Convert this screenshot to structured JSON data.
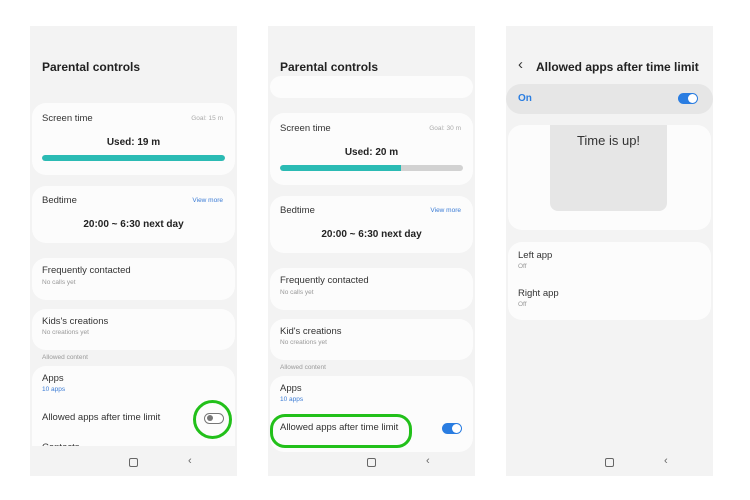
{
  "panel1": {
    "title": "Parental controls",
    "screen_time": {
      "label": "Screen time",
      "goal": "Goal: 15 m",
      "used": "Used: 19 m",
      "progress": 1.0
    },
    "bedtime": {
      "label": "Bedtime",
      "view_more": "View more",
      "time": "20:00 ~ 6:30 next day"
    },
    "frequent": {
      "label": "Frequently contacted",
      "sub": "No calls yet"
    },
    "creations": {
      "label": "Kids's creations",
      "sub": "No creations yet"
    },
    "section": "Allowed content",
    "apps": {
      "label": "Apps",
      "sub": "10 apps"
    },
    "allowed_apps": {
      "label": "Allowed apps after time limit",
      "toggle": "off"
    },
    "contacts": "Contacts"
  },
  "panel2": {
    "title": "Parental controls",
    "screen_time": {
      "label": "Screen time",
      "goal": "Goal: 30 m",
      "used": "Used: 20 m",
      "progress": 0.66
    },
    "bedtime": {
      "label": "Bedtime",
      "view_more": "View more",
      "time": "20:00 ~ 6:30 next day"
    },
    "frequent": {
      "label": "Frequently contacted",
      "sub": "No calls yet"
    },
    "creations": {
      "label": "Kid's creations",
      "sub": "No creations yet"
    },
    "section": "Allowed content",
    "apps": {
      "label": "Apps",
      "sub": "10 apps"
    },
    "allowed_apps": {
      "label": "Allowed apps after time limit",
      "toggle": "on"
    }
  },
  "panel3": {
    "title": "Allowed apps after time limit",
    "on_label": "On",
    "toggle": "on",
    "preview": "Time is up!",
    "left_app": {
      "label": "Left app",
      "sub": "Off"
    },
    "right_app": {
      "label": "Right app",
      "sub": "Off"
    }
  },
  "colors": {
    "highlight": "#22c01a",
    "accent": "#2a7de1",
    "progress": "#2bbbb4"
  }
}
